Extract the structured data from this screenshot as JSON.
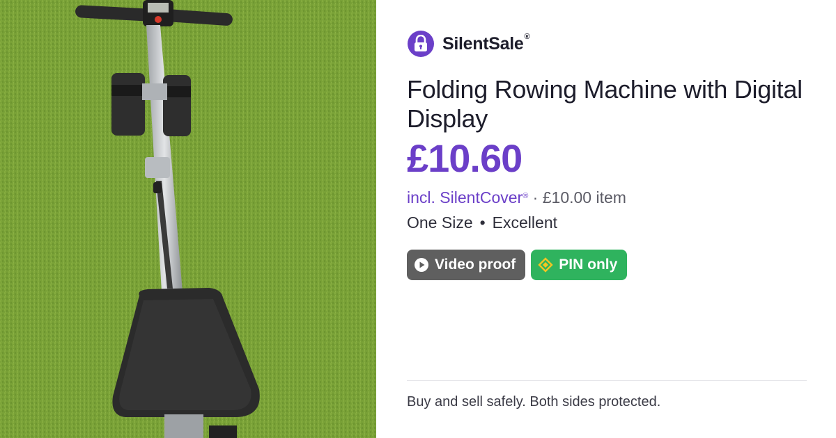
{
  "photo": {
    "description_icon": "rowing-machine-photo"
  },
  "brand": {
    "name": "SilentSale",
    "mark": "®",
    "icon": "padlock-icon",
    "color": "#6b3fc8"
  },
  "listing": {
    "title": "Folding Rowing Machine with Digital Display",
    "price": "£10.60",
    "cover_prefix": "incl. ",
    "cover_name": "SilentCover",
    "cover_mark": "®",
    "cover_suffix": " · £10.00 item",
    "size": "One Size",
    "separator": "•",
    "condition": "Excellent"
  },
  "badges": {
    "video": {
      "label": "Video proof",
      "icon": "play-icon",
      "color": "#5f5f5f"
    },
    "pin": {
      "label": "PIN only",
      "icon": "diamond-tag-icon",
      "color": "#2fb35e"
    }
  },
  "footer": {
    "text": "Buy and sell safely. Both sides protected."
  }
}
